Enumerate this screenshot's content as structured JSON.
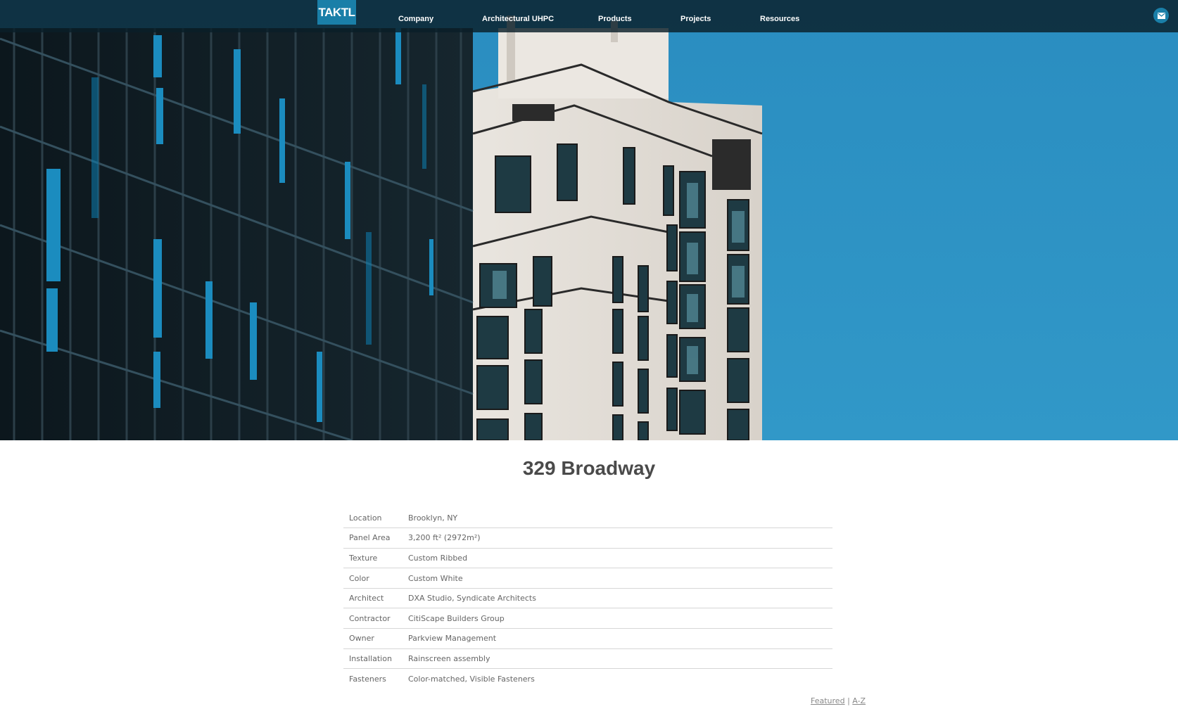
{
  "nav": {
    "logo_text": "TAKTL",
    "items": [
      {
        "label": "Company"
      },
      {
        "label": "Architectural UHPC"
      },
      {
        "label": "Products"
      },
      {
        "label": "Projects"
      },
      {
        "label": "Resources"
      }
    ],
    "contact_icon": "mail-icon"
  },
  "hero": {
    "image": "building-photo",
    "colors": {
      "sky": "#2f93c4",
      "dark_facade": "#0f1d24",
      "white_facade": "#e7e2db",
      "window": "#1d8fc0"
    }
  },
  "project": {
    "title": "329 Broadway",
    "specs": [
      {
        "label": "Location",
        "value": "Brooklyn, NY"
      },
      {
        "label": "Panel Area",
        "value": "3,200 ft² (2972m²)"
      },
      {
        "label": "Texture",
        "value": "Custom Ribbed"
      },
      {
        "label": "Color",
        "value": "Custom White"
      },
      {
        "label": "Architect",
        "value": "DXA Studio, Syndicate Architects"
      },
      {
        "label": "Contractor",
        "value": "CitiScape Builders Group"
      },
      {
        "label": "Owner",
        "value": "Parkview Management"
      },
      {
        "label": "Installation",
        "value": "Rainscreen assembly"
      },
      {
        "label": "Fasteners",
        "value": "Color-matched, Visible Fasteners"
      }
    ]
  },
  "footer_links": {
    "featured": "Featured",
    "separator": "|",
    "az": "A-Z"
  }
}
